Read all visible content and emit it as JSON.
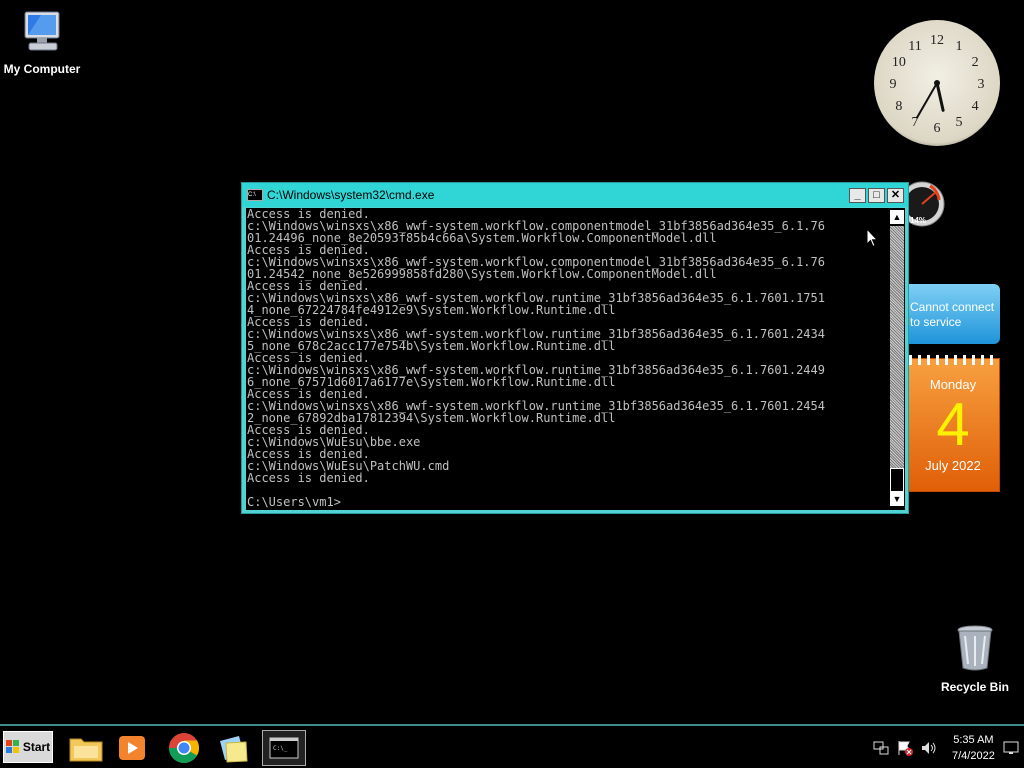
{
  "desktop": {
    "icons": [
      {
        "label": "My Computer",
        "icon": "computer-icon"
      },
      {
        "label": "Recycle Bin",
        "icon": "recycle-bin-icon"
      }
    ]
  },
  "gadgets": {
    "clock": {
      "hour": 5,
      "minute": 35
    },
    "cpu_meter": {
      "percent_label": "14%"
    },
    "weather": {
      "line1": "Cannot connect",
      "line2": "to service"
    },
    "calendar": {
      "weekday": "Monday",
      "day": "4",
      "month_year": "July 2022"
    }
  },
  "console_window": {
    "title": "C:\\Windows\\system32\\cmd.exe",
    "controls": {
      "minimize": "_",
      "maximize": "□",
      "close": "✕"
    },
    "lines": [
      "Access is denied.",
      "c:\\Windows\\winsxs\\x86_wwf-system.workflow.componentmodel_31bf3856ad364e35_6.1.76",
      "01.24496_none_8e20593f85b4c66a\\System.Workflow.ComponentModel.dll",
      "Access is denied.",
      "c:\\Windows\\winsxs\\x86_wwf-system.workflow.componentmodel_31bf3856ad364e35_6.1.76",
      "01.24542_none_8e526999858fd280\\System.Workflow.ComponentModel.dll",
      "Access is denied.",
      "c:\\Windows\\winsxs\\x86_wwf-system.workflow.runtime_31bf3856ad364e35_6.1.7601.1751",
      "4_none_67224784fe4912e9\\System.Workflow.Runtime.dll",
      "Access is denied.",
      "c:\\Windows\\winsxs\\x86_wwf-system.workflow.runtime_31bf3856ad364e35_6.1.7601.2434",
      "5_none_678c2acc177e754b\\System.Workflow.Runtime.dll",
      "Access is denied.",
      "c:\\Windows\\winsxs\\x86_wwf-system.workflow.runtime_31bf3856ad364e35_6.1.7601.2449",
      "6_none_67571d6017a6177e\\System.Workflow.Runtime.dll",
      "Access is denied.",
      "c:\\Windows\\winsxs\\x86_wwf-system.workflow.runtime_31bf3856ad364e35_6.1.7601.2454",
      "2_none_67892dba17812394\\System.Workflow.Runtime.dll",
      "Access is denied.",
      "c:\\Windows\\WuEsu\\bbe.exe",
      "Access is denied.",
      "c:\\Windows\\WuEsu\\PatchWU.cmd",
      "Access is denied.",
      "",
      "C:\\Users\\vm1>"
    ]
  },
  "taskbar": {
    "start_label": "Start",
    "apps": [
      {
        "name": "file-explorer",
        "icon": "folder-icon"
      },
      {
        "name": "media-player",
        "icon": "media-player-icon"
      },
      {
        "name": "chrome",
        "icon": "chrome-icon"
      },
      {
        "name": "sticky-notes",
        "icon": "sticky-notes-icon"
      },
      {
        "name": "command-prompt",
        "icon": "cmd-icon",
        "active": true
      }
    ],
    "tray": {
      "time": "5:35 AM",
      "date": "7/4/2022"
    }
  },
  "colors": {
    "desktop_bg": "#000000",
    "console_title_bg": "#30d6d6",
    "console_text": "#c0c0c0",
    "calendar_day": "#fff200",
    "calendar_bg": "#e9760f"
  }
}
